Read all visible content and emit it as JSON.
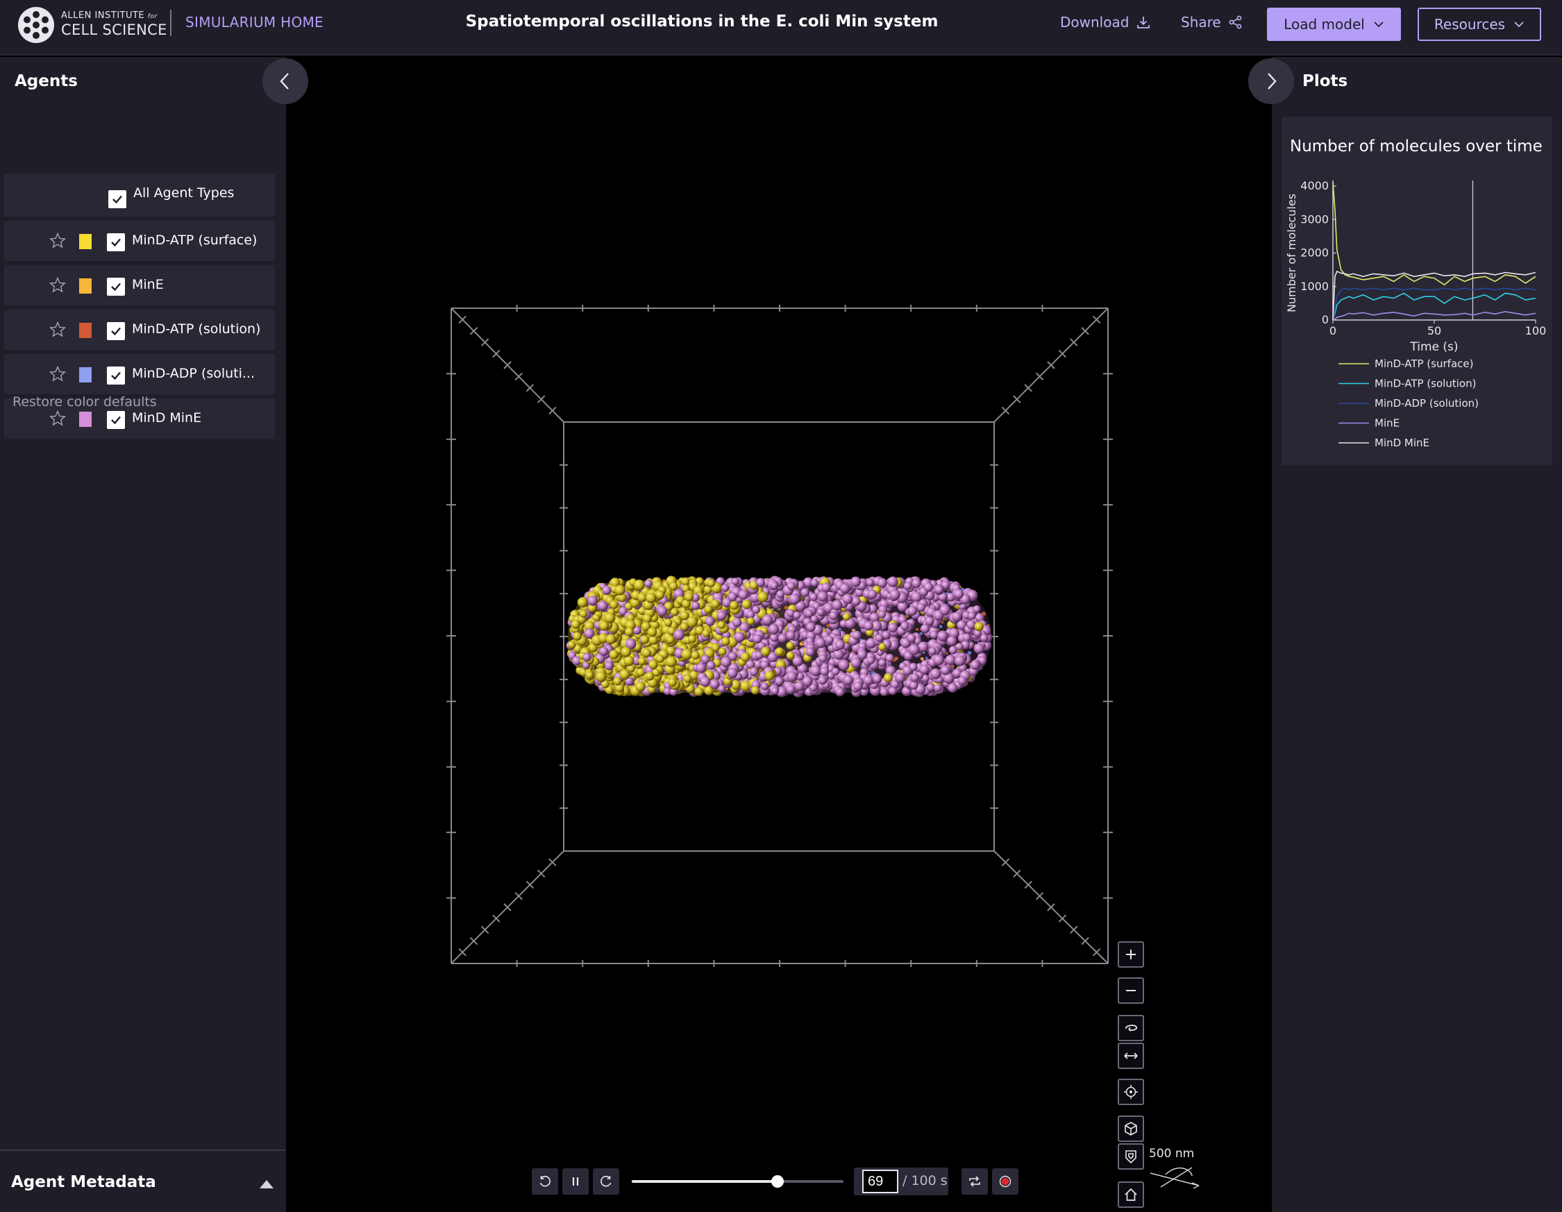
{
  "header": {
    "logo_line1": "ALLEN INSTITUTE",
    "logo_for": "for",
    "logo_line2": "CELL SCIENCE",
    "home": "SIMULARIUM HOME",
    "title": "Spatiotemporal oscillations in the E. coli Min system",
    "download": "Download",
    "share": "Share",
    "load_model": "Load model",
    "resources": "Resources"
  },
  "left_panel": {
    "title": "Agents",
    "all_agent_types": "All Agent Types",
    "agents": [
      {
        "label": "MinD-ATP (surface)",
        "color": "#f5dd32",
        "checked": true
      },
      {
        "label": "MinE",
        "color": "#f7b63a",
        "checked": true
      },
      {
        "label": "MinD-ATP (solution)",
        "color": "#d25a35",
        "checked": true
      },
      {
        "label": "MinD-ADP (soluti...",
        "color": "#8ea1f0",
        "checked": true
      },
      {
        "label": "MinD MinE",
        "color": "#d58fd8",
        "checked": true
      }
    ],
    "restore": "Restore color defaults",
    "metadata": "Agent Metadata"
  },
  "right_panel": {
    "title": "Plots",
    "plot_title": "Number of molecules over time"
  },
  "chart_data": {
    "type": "line",
    "title": "Number of molecules over time",
    "xlabel": "Time (s)",
    "ylabel": "Number of molecules",
    "xlim": [
      0,
      100
    ],
    "ylim": [
      0,
      4000
    ],
    "xticks": [
      0,
      50,
      100
    ],
    "yticks": [
      0,
      1000,
      2000,
      3000,
      4000
    ],
    "current_time": 69,
    "x": [
      0,
      1,
      2,
      4,
      6,
      8,
      10,
      15,
      20,
      25,
      30,
      35,
      40,
      45,
      50,
      55,
      60,
      65,
      69,
      75,
      80,
      85,
      90,
      95,
      100
    ],
    "series": [
      {
        "name": "MinD-ATP (surface)",
        "color": "#e3ea6c",
        "values": [
          4100,
          3300,
          2100,
          1500,
          1350,
          1300,
          1280,
          1200,
          1250,
          1300,
          1150,
          1350,
          1150,
          1300,
          1250,
          1050,
          1300,
          1150,
          1250,
          1300,
          1150,
          1350,
          1300,
          1100,
          1300
        ]
      },
      {
        "name": "MinD-ATP (solution)",
        "color": "#2fd3e6",
        "values": [
          0,
          200,
          450,
          600,
          650,
          700,
          650,
          750,
          600,
          700,
          650,
          800,
          600,
          700,
          700,
          500,
          700,
          600,
          650,
          750,
          600,
          800,
          750,
          600,
          650
        ]
      },
      {
        "name": "MinD-ADP (solution)",
        "color": "#274a9c",
        "values": [
          0,
          300,
          700,
          900,
          950,
          900,
          950,
          900,
          950,
          900,
          950,
          900,
          950,
          900,
          900,
          950,
          900,
          950,
          900,
          950,
          900,
          950,
          900,
          950,
          900
        ]
      },
      {
        "name": "MinE",
        "color": "#9c8ee8",
        "values": [
          0,
          20,
          80,
          110,
          150,
          200,
          180,
          220,
          150,
          200,
          230,
          180,
          120,
          200,
          180,
          150,
          160,
          200,
          150,
          230,
          180,
          250,
          200,
          150,
          200
        ]
      },
      {
        "name": "MinD MinE",
        "color": "#e8e8e8",
        "values": [
          0,
          1300,
          1450,
          1400,
          1380,
          1350,
          1380,
          1300,
          1380,
          1350,
          1320,
          1400,
          1300,
          1350,
          1400,
          1320,
          1350,
          1300,
          1380,
          1400,
          1350,
          1420,
          1380,
          1350,
          1420
        ]
      }
    ]
  },
  "playback": {
    "current_time": "69",
    "total_time": "/ 100 s",
    "progress": 0.69
  },
  "viewport": {
    "scale_label": "500 nm"
  }
}
